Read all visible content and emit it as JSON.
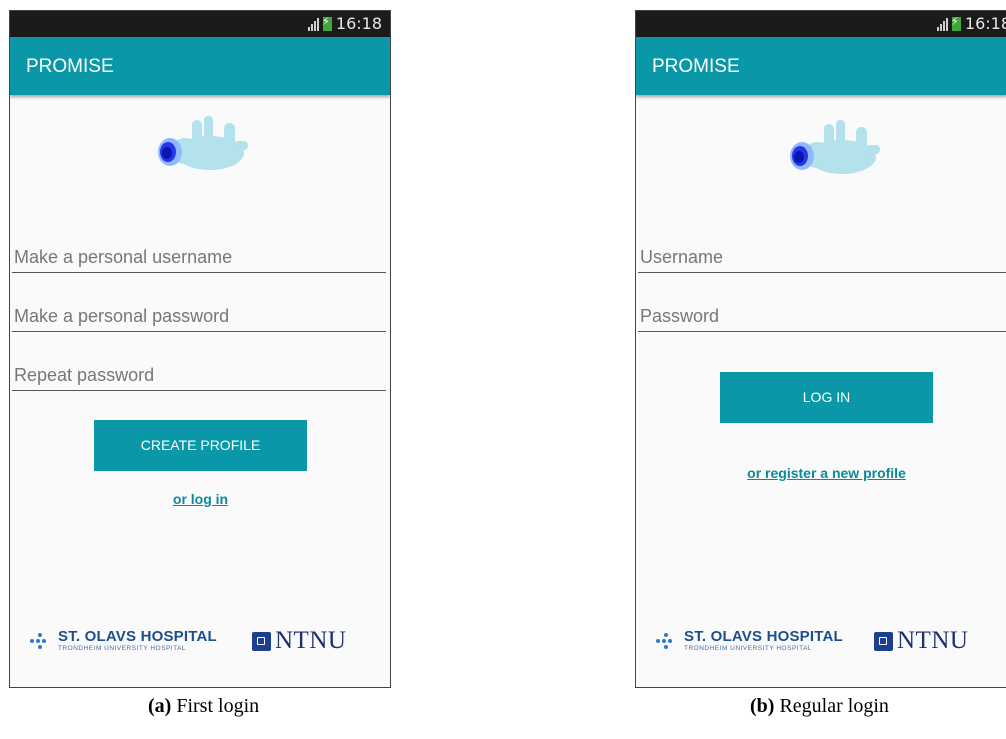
{
  "colors": {
    "accent": "#0a98a8",
    "statusbar": "#1b1b1b",
    "background": "#fafafa",
    "hospital_blue": "#1c4f8f",
    "ntnu_blue": "#1c3f8f"
  },
  "screens": [
    {
      "status_time": "16:18",
      "app_title": "PROMISE",
      "fields": [
        {
          "placeholder": "Make a personal username"
        },
        {
          "placeholder": "Make a personal password"
        },
        {
          "placeholder": "Repeat password"
        }
      ],
      "primary_button": "CREATE PROFILE",
      "secondary_link": "or log in",
      "caption_label": "(a)",
      "caption_text": " First login"
    },
    {
      "status_time": "16:18",
      "app_title": "PROMISE",
      "fields": [
        {
          "placeholder": "Username"
        },
        {
          "placeholder": "Password"
        }
      ],
      "primary_button": "LOG IN",
      "secondary_link": "or register a new profile",
      "caption_label": "(b)",
      "caption_text": " Regular login"
    }
  ],
  "footer": {
    "hospital_name": "ST. OLAVS HOSPITAL",
    "hospital_sub": "TRONDHEIM UNIVERSITY HOSPITAL",
    "university": "NTNU"
  },
  "icons": {
    "logo": "baby-icon",
    "signal": "signal-icon",
    "battery": "battery-charging-icon"
  }
}
